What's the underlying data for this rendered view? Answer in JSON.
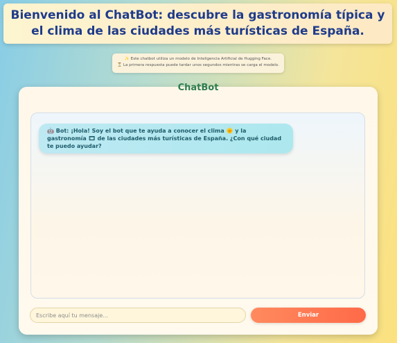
{
  "header": {
    "title": "Bienvenido al ChatBot: descubre la gastronomía típica y el clima de las ciudades más turísticas de España."
  },
  "info": {
    "line1_icon": "✨",
    "line1": "Este chatbot utiliza un modelo de Inteligencia Artificial de Hugging Face.",
    "line2_icon": "⏳",
    "line2": "La primera respuesta puede tardar unos segundos mientras se carga el modelo."
  },
  "chat": {
    "title": "ChatBot",
    "messages": [
      {
        "bot_icon": "🤖",
        "sender": "Bot:",
        "text": "¡Hola! Soy el bot que te ayuda a conocer el clima 🌞 y la gastronomía 🎞 de las ciudades más turísticas de España. ¿Con qué ciudad te puedo ayudar?"
      }
    ]
  },
  "input": {
    "placeholder": "Escribe aquí tu mensaje...",
    "value": ""
  },
  "send_button": {
    "label": "Enviar"
  },
  "colors": {
    "title_text": "#1f3b8a",
    "chat_title": "#2e7d4f",
    "send_button": "#ff6a48",
    "bot_bubble": "#b5e8f0"
  }
}
